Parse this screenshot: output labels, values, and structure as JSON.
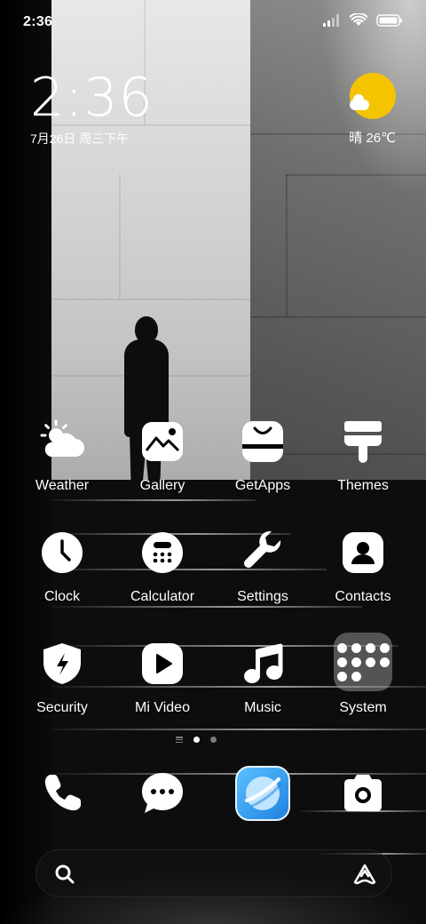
{
  "status_bar": {
    "time": "2:36",
    "icons": [
      "signal-icon",
      "wifi-icon",
      "battery-icon"
    ]
  },
  "clock_widget": {
    "time": "2:36",
    "date": "7月26日 周三下午"
  },
  "weather_widget": {
    "condition_temp": "晴 26℃",
    "icon": "sunny-partly-cloudy-icon",
    "sun_color": "#F5C400"
  },
  "apps": [
    {
      "label": "Weather",
      "icon": "weather-icon"
    },
    {
      "label": "Gallery",
      "icon": "gallery-icon"
    },
    {
      "label": "GetApps",
      "icon": "getapps-bag-icon"
    },
    {
      "label": "Themes",
      "icon": "themes-brush-icon"
    },
    {
      "label": "Clock",
      "icon": "clock-icon"
    },
    {
      "label": "Calculator",
      "icon": "calculator-icon"
    },
    {
      "label": "Settings",
      "icon": "wrench-icon"
    },
    {
      "label": "Contacts",
      "icon": "contacts-icon"
    },
    {
      "label": "Security",
      "icon": "shield-bolt-icon"
    },
    {
      "label": "Mi Video",
      "icon": "play-icon"
    },
    {
      "label": "Music",
      "icon": "music-note-icon"
    },
    {
      "label": "System",
      "icon": "folder-icon"
    }
  ],
  "page_indicator": {
    "pages": 2,
    "active": 1
  },
  "dock": [
    {
      "name": "Phone",
      "icon": "phone-icon"
    },
    {
      "name": "Messaging",
      "icon": "chat-bubble-icon"
    },
    {
      "name": "Browser",
      "icon": "browser-planet-icon",
      "accent": "#2F9BF0"
    },
    {
      "name": "Camera",
      "icon": "camera-icon"
    }
  ],
  "search_bar": {
    "placeholder": "",
    "icons": [
      "search-icon",
      "assistant-icon"
    ]
  }
}
